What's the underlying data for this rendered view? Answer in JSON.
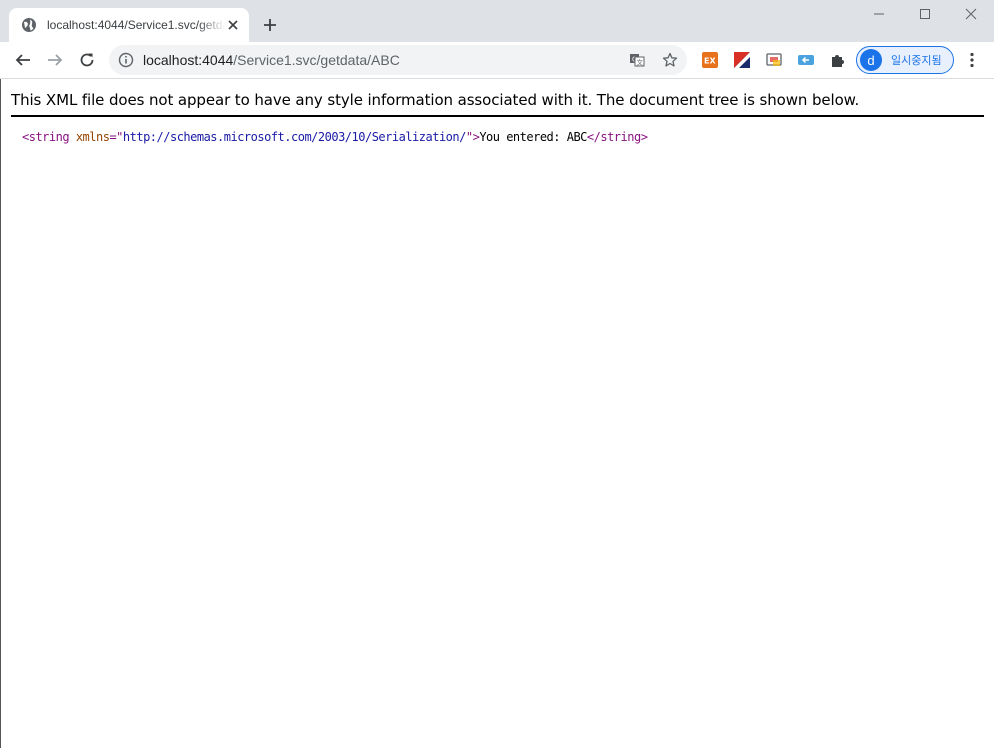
{
  "browser": {
    "tab": {
      "title": "localhost:4044/Service1.svc/getdata/ABC",
      "favicon": "globe-icon"
    },
    "address_bar": {
      "url_host": "localhost:4044",
      "url_path": "/Service1.svc/getdata/ABC"
    },
    "profile": {
      "initial": "d",
      "label": "일시중지됨"
    },
    "colors": {
      "tabstrip": "#dee1e6",
      "accent": "#1a73e8",
      "omnibox": "#f1f3f4"
    }
  },
  "document": {
    "header": "This XML file does not appear to have any style information associated with it. The document tree is shown below.",
    "tree": {
      "open_tag_start": "<string",
      "attr_name": "xmlns",
      "attr_eq": "=\"",
      "attr_value": "http://schemas.microsoft.com/2003/10/Serialization/",
      "open_tag_end": "\">",
      "text": "You entered: ABC",
      "close_tag": "</string>"
    }
  }
}
